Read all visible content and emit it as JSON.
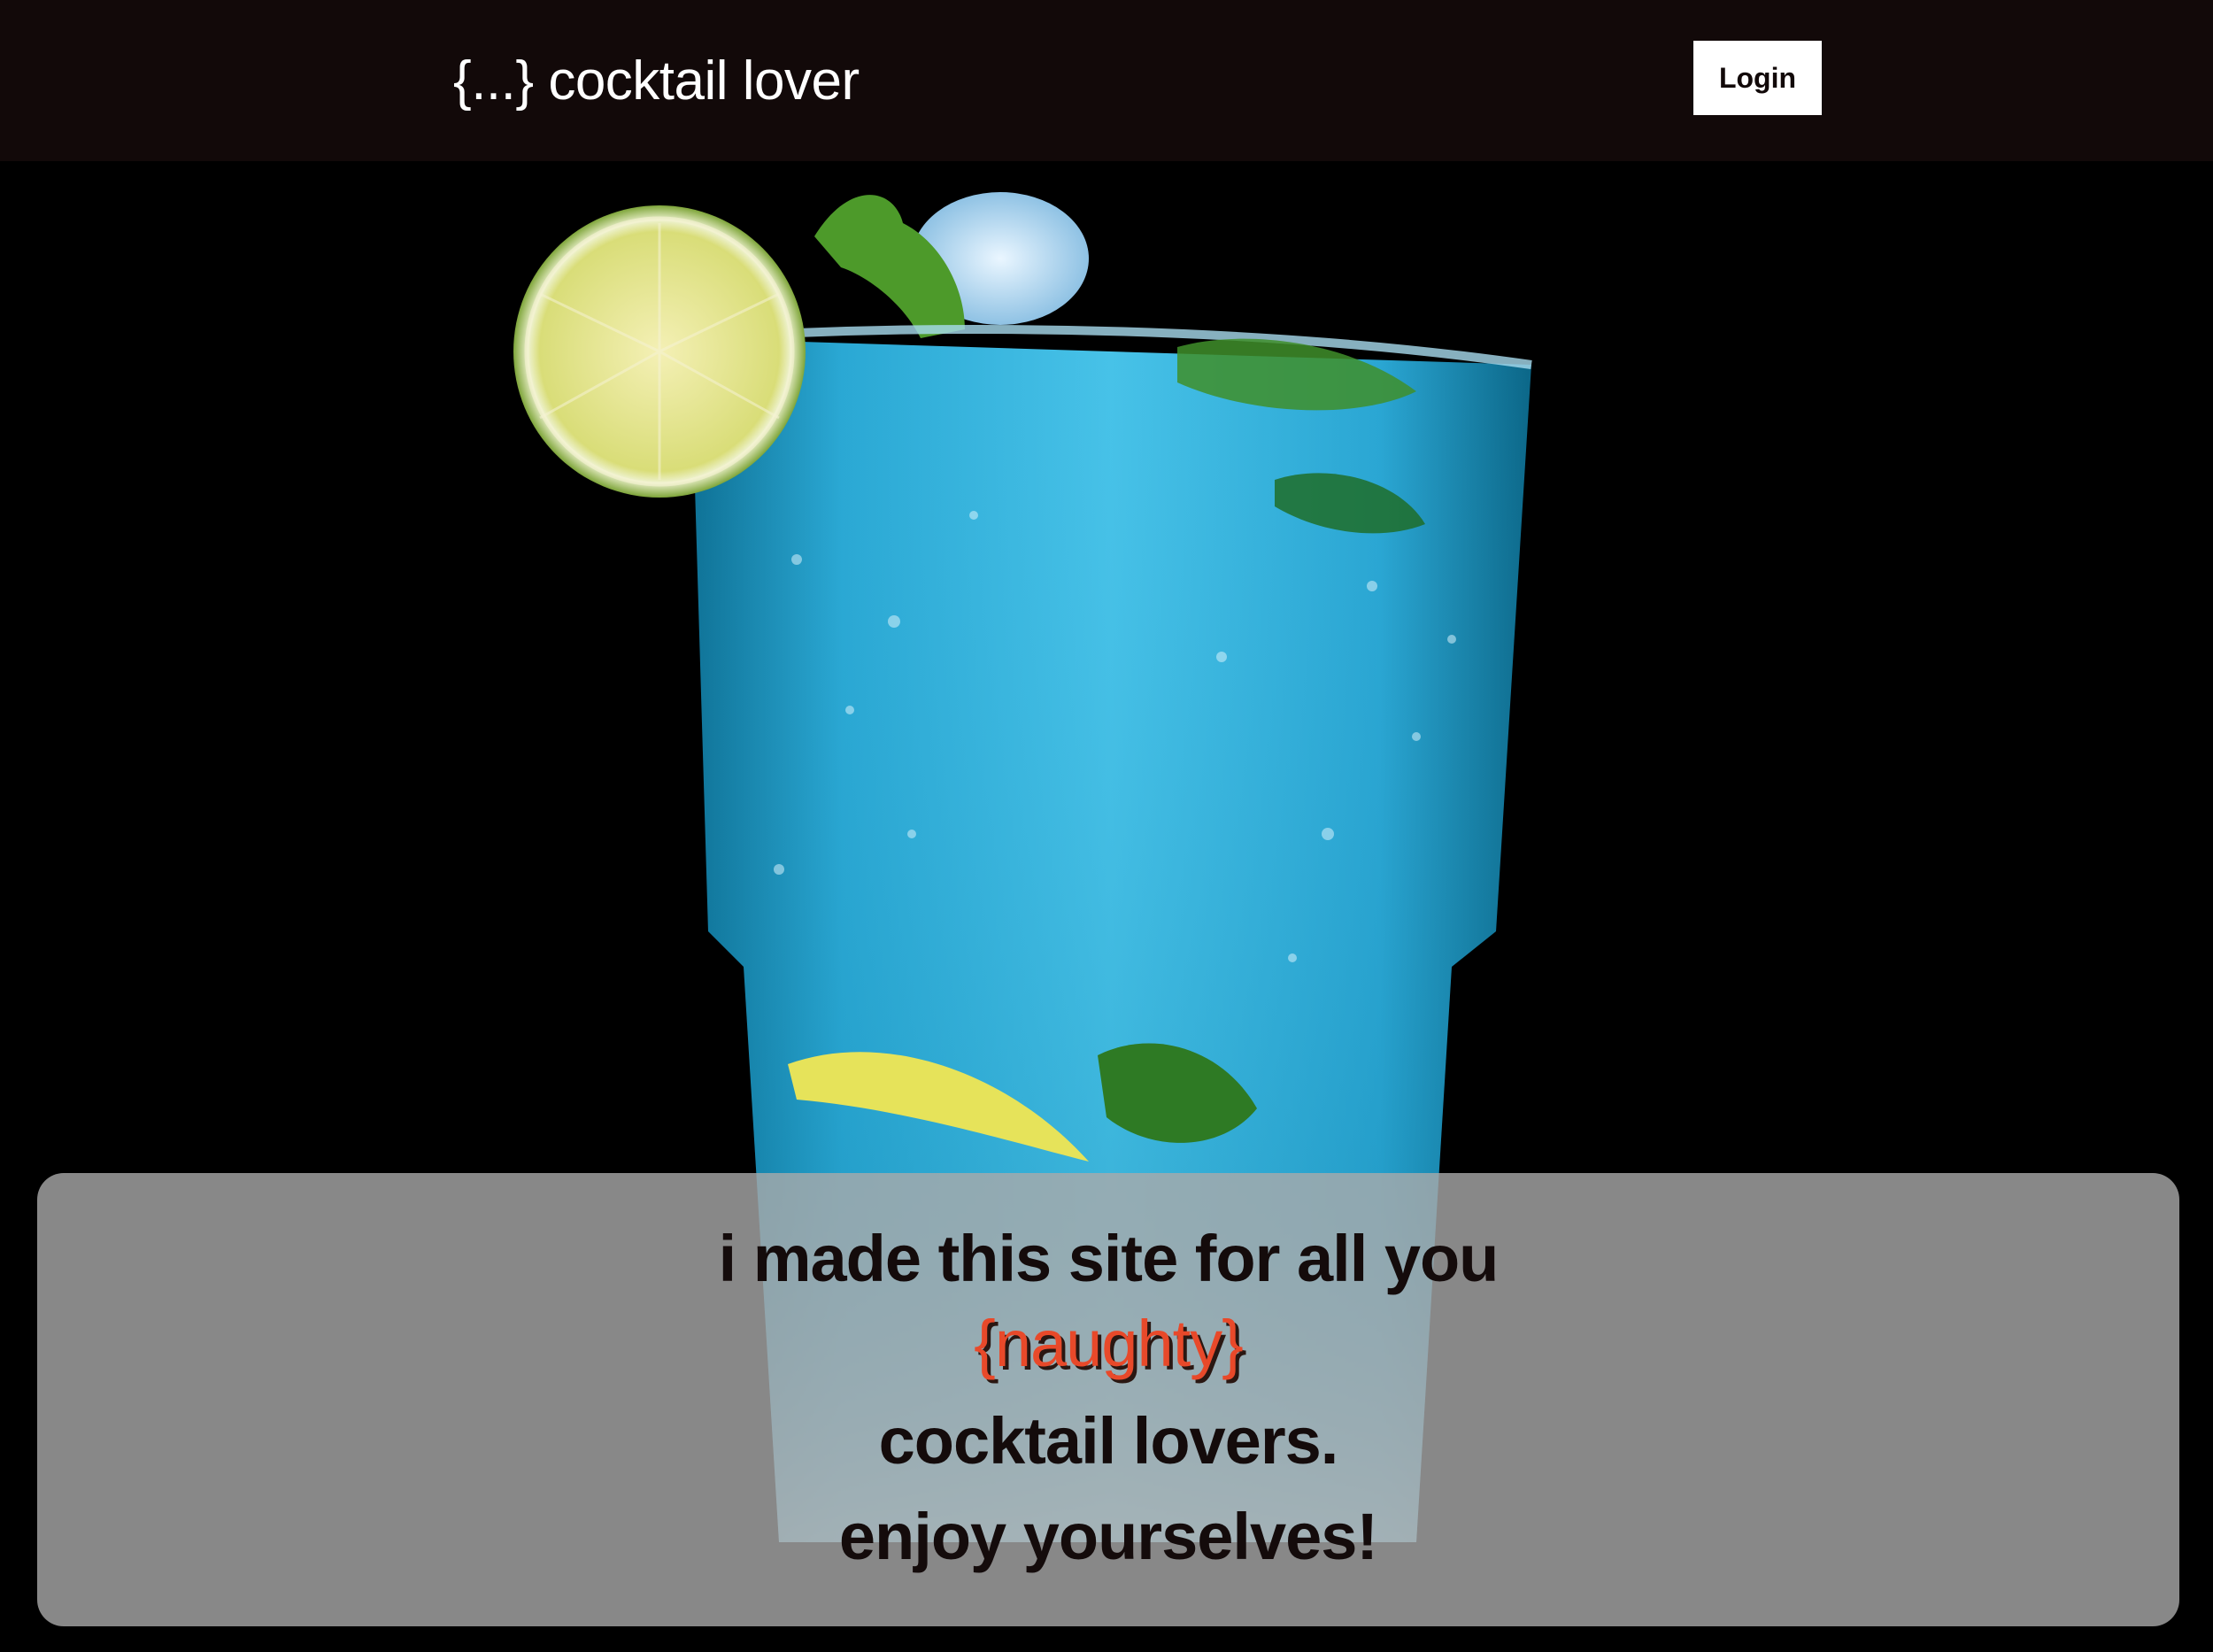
{
  "header": {
    "brand": "{...} cocktail lover",
    "login_label": "Login"
  },
  "hero": {
    "image_icon": "cocktail-glass-icon"
  },
  "message": {
    "line1": "i made this site for all you",
    "line2": "{naughty}",
    "line3": "cocktail lovers.",
    "line4": "enjoy yourselves!"
  },
  "colors": {
    "navbar": "#120909",
    "accent": "#e8492a",
    "text_dark": "#140b0b",
    "panel": "#aaaaaa"
  }
}
